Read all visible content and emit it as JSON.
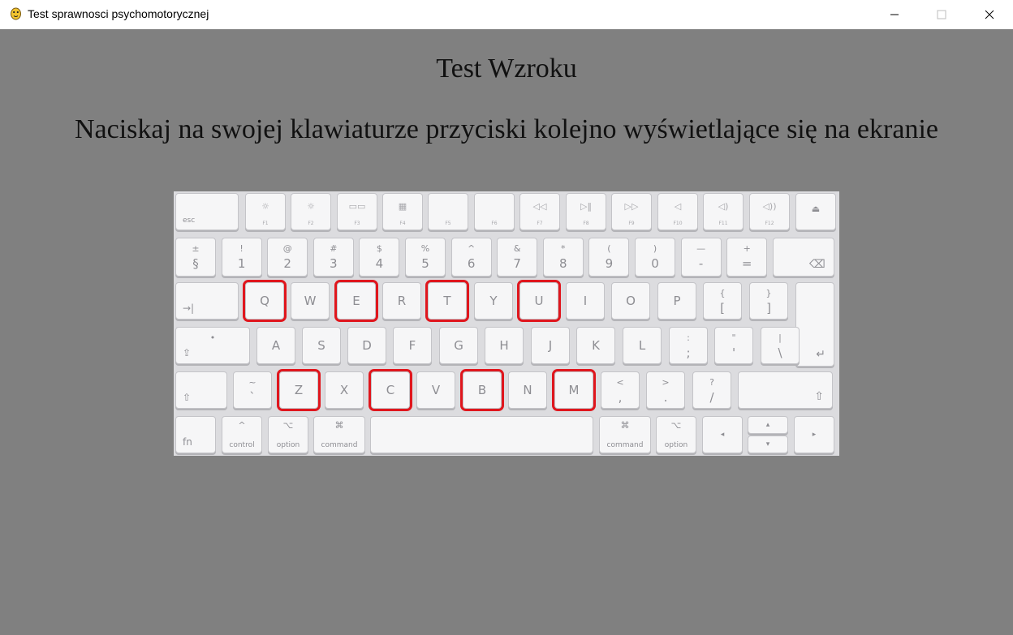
{
  "window": {
    "title": "Test sprawnosci psychomotorycznej",
    "icon": "python-snake-icon",
    "controls": [
      "minimize-icon",
      "maximize-icon",
      "close-icon"
    ]
  },
  "page": {
    "heading": "Test Wzroku",
    "instruction": "Naciskaj na swojej klawiaturze przyciski kolejno wyświetlające się na ekranie"
  },
  "keyboard": {
    "highlight_color": "#e0161d",
    "highlighted_keys": [
      "Q",
      "E",
      "T",
      "U",
      "Z",
      "C",
      "B",
      "M"
    ],
    "function_row": [
      {
        "label": "esc"
      },
      {
        "label": "F1",
        "symbol": "☼"
      },
      {
        "label": "F2",
        "symbol": "☼"
      },
      {
        "label": "F3",
        "symbol": "▭▭"
      },
      {
        "label": "F4",
        "symbol": "▦"
      },
      {
        "label": "F5",
        "symbol": ""
      },
      {
        "label": "F6",
        "symbol": ""
      },
      {
        "label": "F7",
        "symbol": "◁◁"
      },
      {
        "label": "F8",
        "symbol": "▷‖"
      },
      {
        "label": "F9",
        "symbol": "▷▷"
      },
      {
        "label": "F10",
        "symbol": "◁"
      },
      {
        "label": "F11",
        "symbol": "◁)"
      },
      {
        "label": "F12",
        "symbol": "◁))"
      },
      {
        "label": "⏏"
      }
    ],
    "number_row": [
      {
        "top": "±",
        "main": "§"
      },
      {
        "top": "!",
        "main": "1"
      },
      {
        "top": "@",
        "main": "2"
      },
      {
        "top": "#",
        "main": "3"
      },
      {
        "top": "$",
        "main": "4"
      },
      {
        "top": "%",
        "main": "5"
      },
      {
        "top": "^",
        "main": "6"
      },
      {
        "top": "&",
        "main": "7"
      },
      {
        "top": "*",
        "main": "8"
      },
      {
        "top": "(",
        "main": "9"
      },
      {
        "top": ")",
        "main": "0"
      },
      {
        "top": "—",
        "main": "-"
      },
      {
        "top": "+",
        "main": "="
      },
      {
        "top": "",
        "main": "⌫"
      }
    ],
    "qwerty_row": [
      {
        "main": "→|"
      },
      {
        "main": "Q"
      },
      {
        "main": "W"
      },
      {
        "main": "E"
      },
      {
        "main": "R"
      },
      {
        "main": "T"
      },
      {
        "main": "Y"
      },
      {
        "main": "U"
      },
      {
        "main": "I"
      },
      {
        "main": "O"
      },
      {
        "main": "P"
      },
      {
        "top": "{",
        "main": "["
      },
      {
        "top": "}",
        "main": "]"
      },
      {
        "main": "↵"
      }
    ],
    "home_row": [
      {
        "top": "•",
        "main": "⇪"
      },
      {
        "main": "A"
      },
      {
        "main": "S"
      },
      {
        "main": "D"
      },
      {
        "main": "F"
      },
      {
        "main": "G"
      },
      {
        "main": "H"
      },
      {
        "main": "J"
      },
      {
        "main": "K"
      },
      {
        "main": "L"
      },
      {
        "top": ":",
        "main": ";"
      },
      {
        "top": "\"",
        "main": "'"
      },
      {
        "top": "|",
        "main": "\\"
      }
    ],
    "bottom_letter_row": [
      {
        "main": "⇧"
      },
      {
        "top": "~",
        "main": "`"
      },
      {
        "main": "Z"
      },
      {
        "main": "X"
      },
      {
        "main": "C"
      },
      {
        "main": "V"
      },
      {
        "main": "B"
      },
      {
        "main": "N"
      },
      {
        "main": "M"
      },
      {
        "top": "<",
        "main": ","
      },
      {
        "top": ">",
        "main": "."
      },
      {
        "top": "?",
        "main": "/"
      },
      {
        "main": "⇧"
      }
    ],
    "modifier_row": [
      {
        "main": "fn"
      },
      {
        "top": "^",
        "main": "control"
      },
      {
        "top": "⌥",
        "main": "option"
      },
      {
        "top": "⌘",
        "main": "command"
      },
      {
        "main": ""
      },
      {
        "top": "⌘",
        "main": "command"
      },
      {
        "top": "⌥",
        "main": "option"
      },
      {
        "main": "◂"
      },
      {
        "main": "▴"
      },
      {
        "main": "▾"
      },
      {
        "main": "▸"
      }
    ]
  }
}
